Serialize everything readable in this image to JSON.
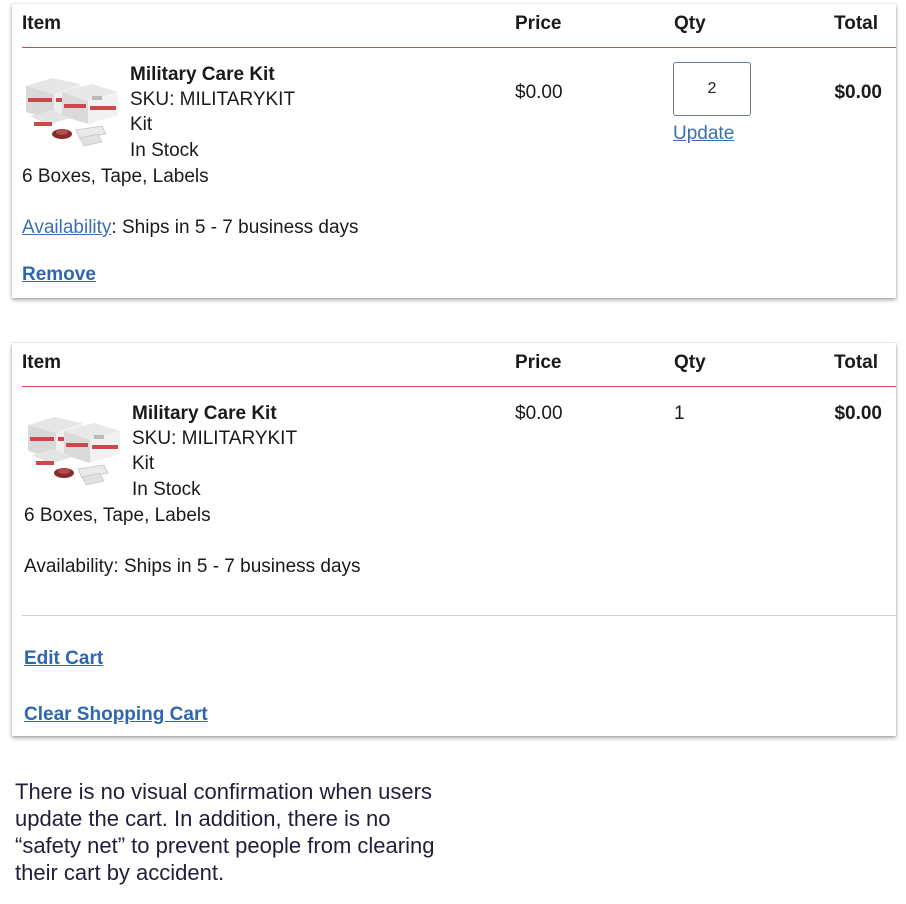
{
  "columns": {
    "item": "Item",
    "price": "Price",
    "qty": "Qty",
    "total": "Total"
  },
  "cart_row_1": {
    "name": "Military Care Kit",
    "sku": "SKU: MILITARYKIT",
    "type": "Kit",
    "stock": "In Stock",
    "contents": "6 Boxes, Tape, Labels",
    "availability_link": "Availability",
    "availability_text": ": Ships in 5 - 7 business days",
    "price": "$0.00",
    "qty_value": "2",
    "update_label": "Update",
    "total": "$0.00",
    "remove_label": "Remove"
  },
  "cart_row_2": {
    "name": "Military Care Kit",
    "sku": "SKU: MILITARYKIT",
    "type": "Kit",
    "stock": "In Stock",
    "contents": "6 Boxes, Tape, Labels",
    "availability": "Availability: Ships in 5 - 7 business days",
    "price": "$0.00",
    "qty": "1",
    "total": "$0.00",
    "edit_cart_label": "Edit Cart",
    "clear_cart_label": "Clear Shopping Cart"
  },
  "caption": "There is no visual confirmation when users update the cart. In addition, there is no “safety net” to prevent people from clearing their cart by accident."
}
